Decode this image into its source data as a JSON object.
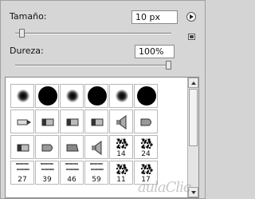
{
  "size": {
    "label": "Tamaño:",
    "value": "10 px",
    "slider_fraction": 0.04
  },
  "hardness": {
    "label": "Dureza:",
    "value": "100%",
    "slider_fraction": 1.0
  },
  "icons": {
    "menu": "flyout-menu-icon",
    "new": "create-preset-icon"
  },
  "brushes": [
    {
      "kind": "soft",
      "label": ""
    },
    {
      "kind": "hard",
      "label": ""
    },
    {
      "kind": "soft",
      "label": ""
    },
    {
      "kind": "hard",
      "label": ""
    },
    {
      "kind": "soft",
      "label": ""
    },
    {
      "kind": "hard",
      "label": ""
    },
    {
      "kind": "pen",
      "label": ""
    },
    {
      "kind": "marker",
      "label": ""
    },
    {
      "kind": "marker",
      "label": ""
    },
    {
      "kind": "marker",
      "label": ""
    },
    {
      "kind": "speaker",
      "label": ""
    },
    {
      "kind": "bullet",
      "label": ""
    },
    {
      "kind": "marker",
      "label": ""
    },
    {
      "kind": "bullet",
      "label": ""
    },
    {
      "kind": "wedge",
      "label": ""
    },
    {
      "kind": "speaker",
      "label": ""
    },
    {
      "kind": "splat",
      "label": "14"
    },
    {
      "kind": "splat",
      "label": "24"
    },
    {
      "kind": "spray",
      "label": "27"
    },
    {
      "kind": "spray",
      "label": "39"
    },
    {
      "kind": "spray",
      "label": "46"
    },
    {
      "kind": "spray",
      "label": "59"
    },
    {
      "kind": "splat",
      "label": "11"
    },
    {
      "kind": "splat",
      "label": "17"
    }
  ],
  "watermark": "aulaClic"
}
